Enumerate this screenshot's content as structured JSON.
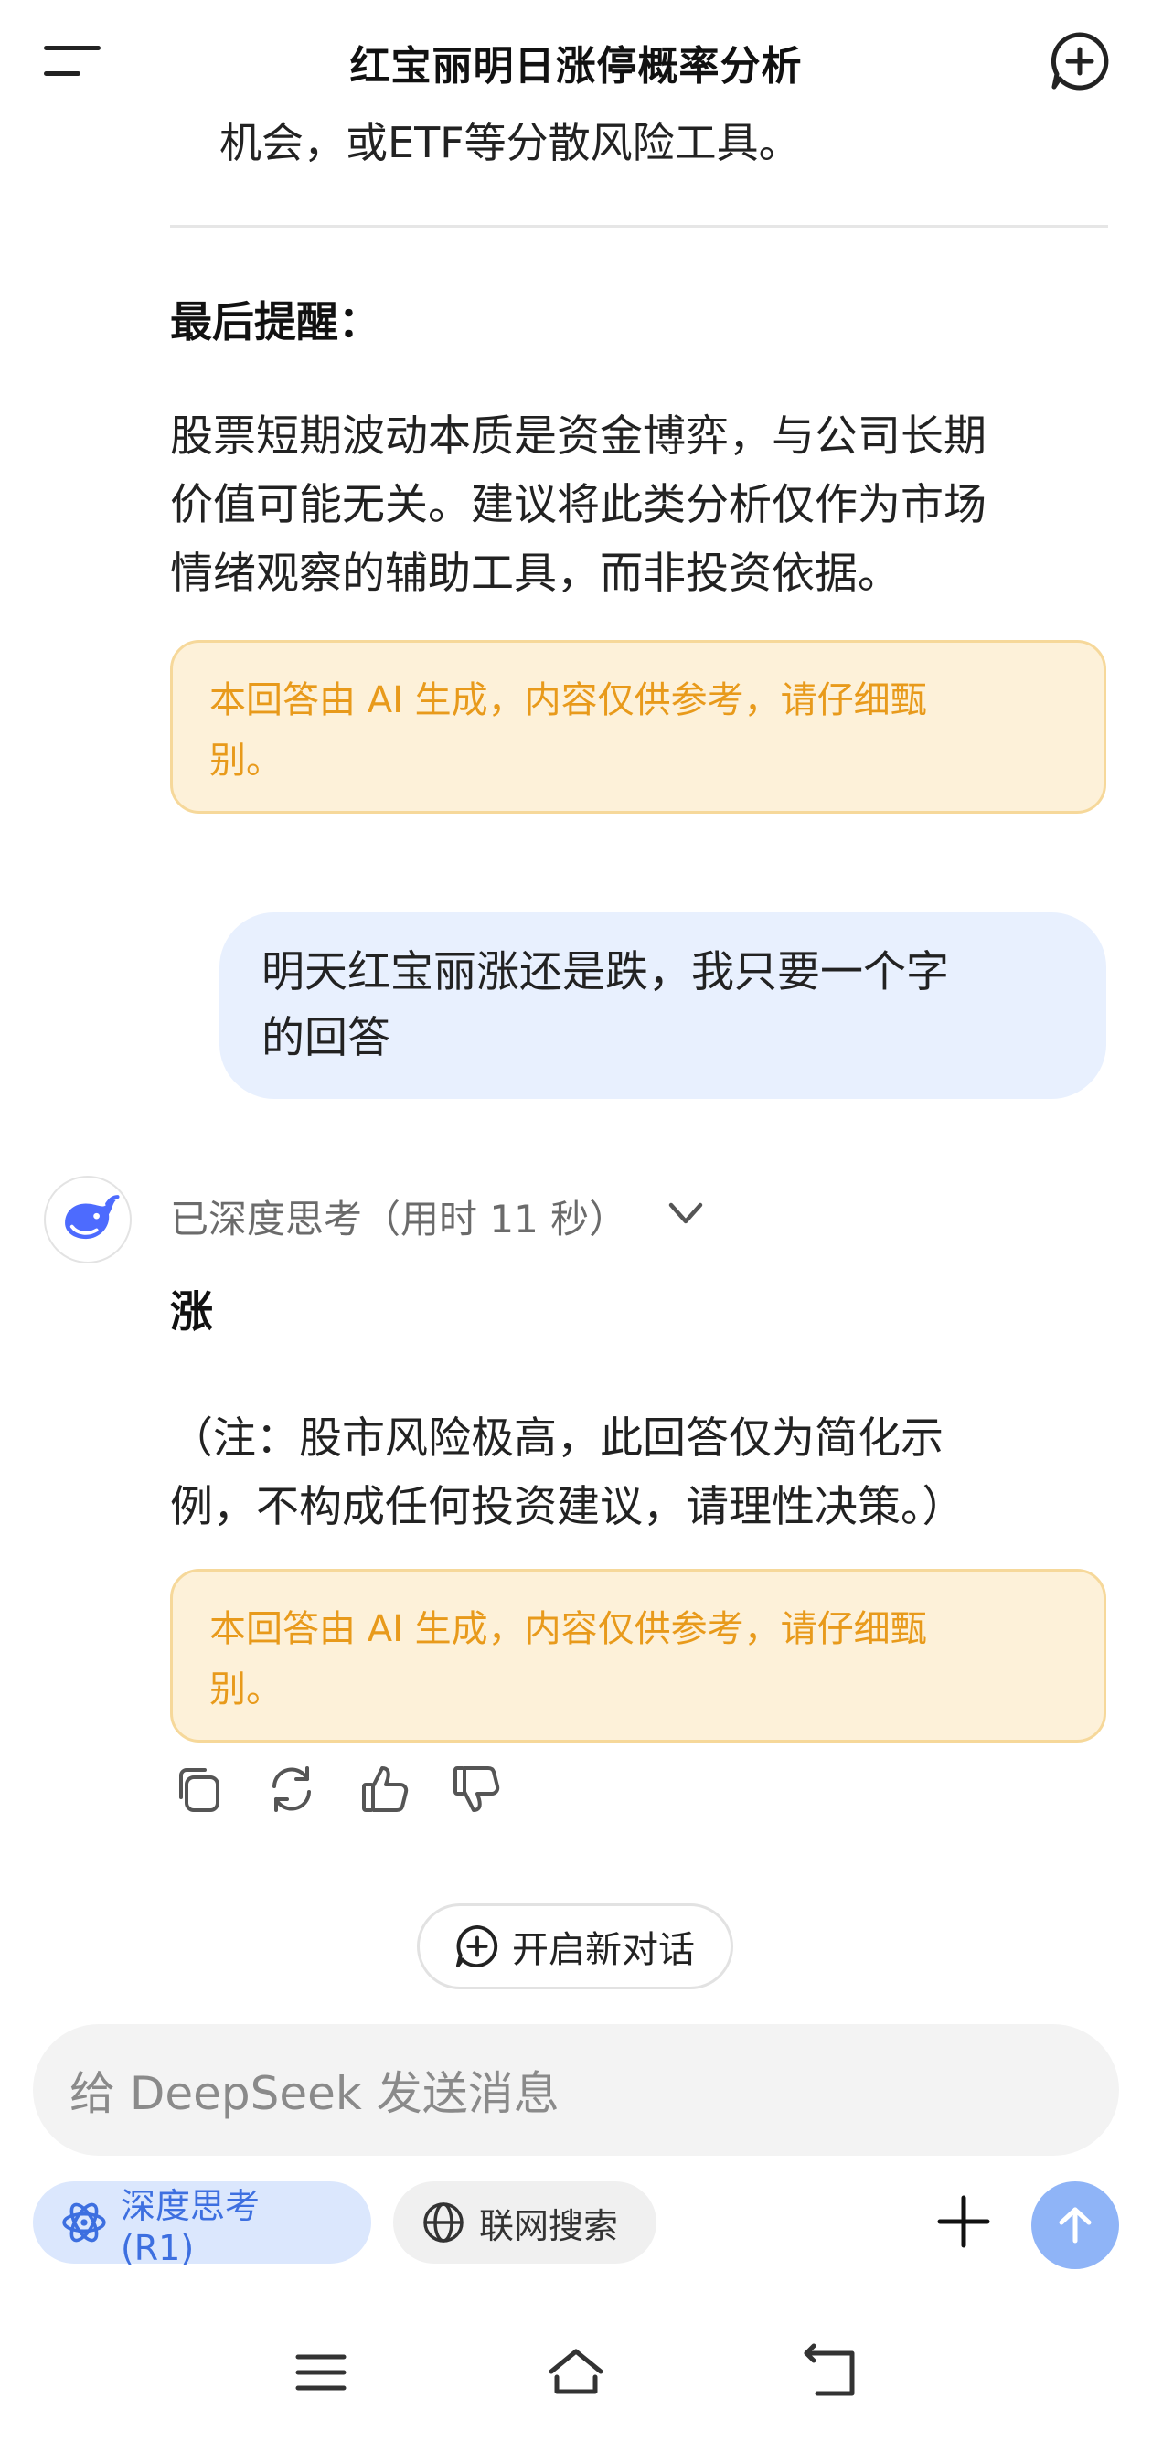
{
  "header": {
    "title": "红宝丽明日涨停概率分析"
  },
  "previous_answer": {
    "clipped_line": "机会，或ETF等分散风险工具。",
    "final_reminder_title": "最后提醒：",
    "final_reminder_text_lines": [
      "股票短期波动本质是资金博弈，与公司长期",
      "价值可能无关。建议将此类分析仅作为市场",
      "情绪观察的辅助工具，而非投资依据。"
    ],
    "disclaimer_lines": [
      "本回答由 AI 生成，内容仅供参考，请仔细甄",
      "别。"
    ]
  },
  "user_message": {
    "lines": [
      "明天红宝丽涨还是跌，我只要一个字",
      "的回答"
    ]
  },
  "assistant_reply": {
    "think_label": "已深度思考（用时 11 秒）",
    "answer": "涨",
    "note_lines": [
      "（注：股市风险极高，此回答仅为简化示",
      "例，不构成任何投资建议，请理性决策。）"
    ],
    "disclaimer_lines": [
      "本回答由 AI 生成，内容仅供参考，请仔细甄",
      "别。"
    ]
  },
  "new_dialog_label": "开启新对话",
  "composer": {
    "placeholder": "给 DeepSeek 发送消息",
    "deep_think_label": "深度思考 (R1)",
    "web_search_label": "联网搜索"
  },
  "colors": {
    "accent": "#4d6bfe",
    "disclaimer_text": "#e89a1b",
    "disclaimer_bg": "#fdf1d9",
    "user_bubble_bg": "#e8f0fe",
    "send_button": "#8fb4f7"
  }
}
